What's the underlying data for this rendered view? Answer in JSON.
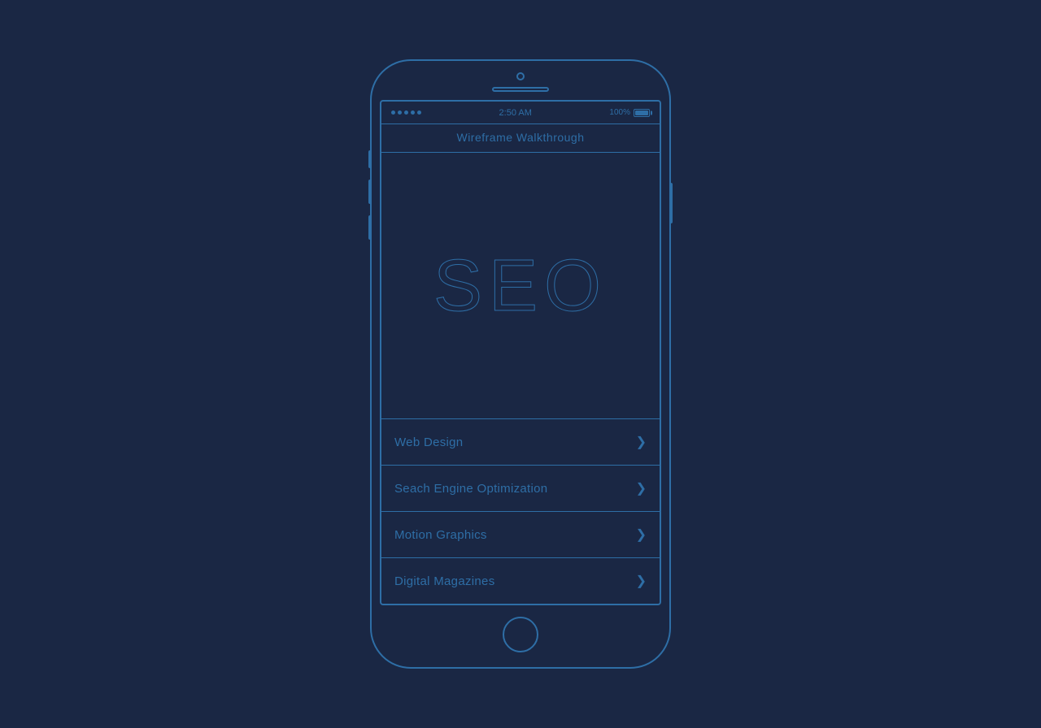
{
  "page": {
    "background_color": "#1a2744",
    "accent_color": "#2e6ea6"
  },
  "phone": {
    "status_bar": {
      "time": "2:50 AM",
      "battery_percent": "100%"
    },
    "app_title": "Wireframe Walkthrough",
    "hero": {
      "text": "SEO"
    },
    "menu_items": [
      {
        "label": "Web Design",
        "id": "web-design"
      },
      {
        "label": "Seach Engine Optimization",
        "id": "seo"
      },
      {
        "label": "Motion Graphics",
        "id": "motion-graphics"
      },
      {
        "label": "Digital Magazines",
        "id": "digital-magazines"
      }
    ],
    "chevron": "❯"
  }
}
